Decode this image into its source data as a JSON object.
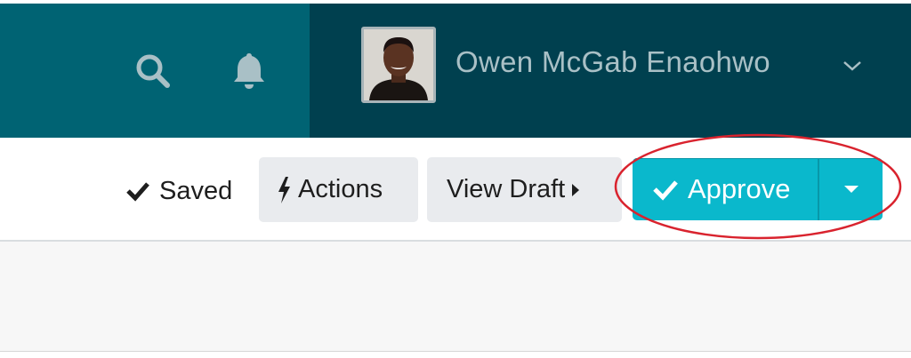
{
  "header": {
    "user_name": "Owen McGab Enaohwo",
    "icons": {
      "search": "search-icon",
      "notifications": "bell-icon",
      "menu": "chevron-down-icon"
    },
    "colors": {
      "left_bg": "#006373",
      "right_bg": "#00404f",
      "text": "#a9c0c6"
    }
  },
  "toolbar": {
    "saved_label": "Saved",
    "actions_label": "Actions",
    "view_draft_label": "View Draft",
    "approve_label": "Approve",
    "colors": {
      "approve_bg": "#0ab8cc",
      "button_bg": "#e9ebee",
      "highlight": "#d9232e"
    }
  }
}
